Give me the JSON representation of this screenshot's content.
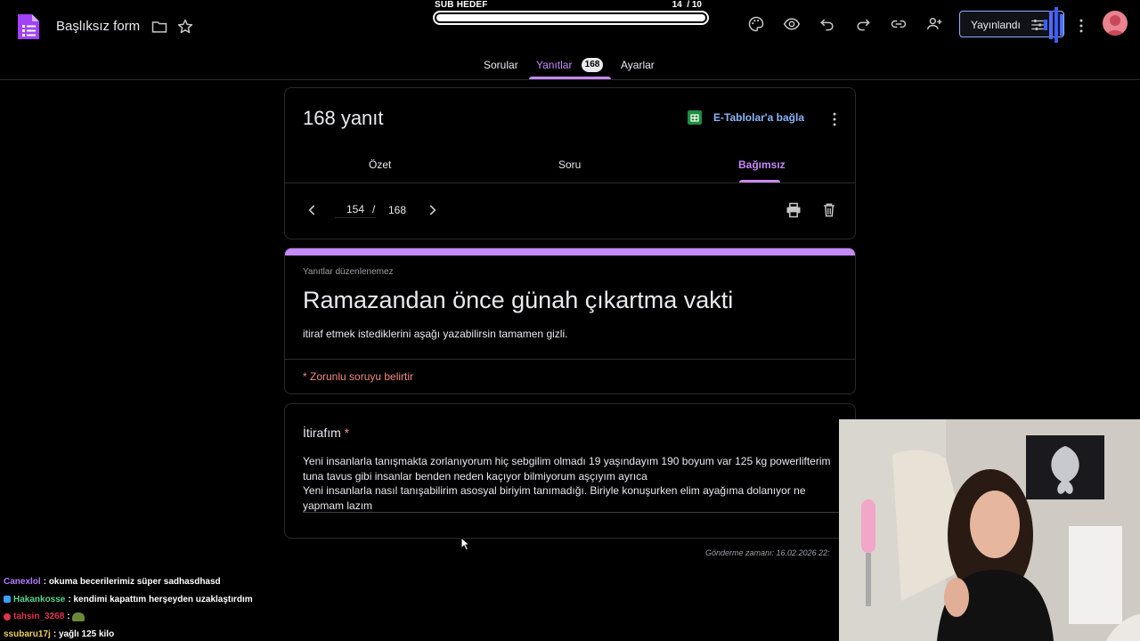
{
  "header": {
    "doc_title": "Başlıksız form",
    "publish_label": "Yayınlandı",
    "icons": [
      "forms-logo-icon",
      "folder-icon",
      "star-icon",
      "palette-icon",
      "preview-icon",
      "undo-icon",
      "redo-icon",
      "link-icon",
      "add-collaborator-icon",
      "more-vert-icon",
      "avatar"
    ]
  },
  "sub_goal": {
    "label": "SUB HEDEF",
    "count": "14",
    "separator": "/",
    "target": "10",
    "progress": 1.0
  },
  "main_tabs": {
    "questions": "Sorular",
    "responses": "Yanıtlar",
    "responses_count": "168",
    "settings": "Ayarlar"
  },
  "responses_card": {
    "title": "168 yanıt",
    "sheets_link": "E-Tablolar'a bağla",
    "tabs": [
      "Özet",
      "Soru",
      "Bağımsız"
    ],
    "active_tab": "Bağımsız",
    "pager": {
      "current": "154",
      "separator": "/",
      "total": "168"
    }
  },
  "form": {
    "readonly_note": "Yanıtlar düzenlenemez",
    "title": "Ramazandan önce günah çıkartma vakti",
    "description": "itiraf etmek istediklerini aşağı yazabilirsin tamamen gizli.",
    "required_note": "* Zorunlu soruyu belirtir",
    "accent_color": "#c58af9"
  },
  "question": {
    "label": "İtirafım",
    "required_mark": "*",
    "answer_lines": [
      "Yeni insanlarla tanışmakta zorlanıyorum  hiç sebgilim olmadı 19 yaşındayım 190 boyum var 125 kg powerlifterim",
      "tuna tavus gibi insanlar benden neden kaçıyor bilmiyorum aşçıyım ayrıca",
      "Yeni insanlarla nasıl tanışabilirim asosyal biriyim tanımadığı. Biriyle konuşurken elim ayağıma dolanıyor  ne",
      "yapmam lazım"
    ]
  },
  "submitted_at": "Gönderme zamanı: 16.02.2026 22:",
  "chat": [
    {
      "user": "Canexlol",
      "sep": ":",
      "message": "okuma becerilerimiz süper sadhasdhasd",
      "color": "#b47cff"
    },
    {
      "user": "Hakankosse",
      "sep": ":",
      "message": "kendimi kapattım herşeyden uzaklaştırdım",
      "color": "#5ad38a"
    },
    {
      "user": "tahsin_3268",
      "sep": ":",
      "message": "",
      "color": "#e0364a"
    },
    {
      "user": "ssubaru17j",
      "sep": ":",
      "message": "yağlı 125 kilo",
      "color": "#f0d060"
    }
  ]
}
